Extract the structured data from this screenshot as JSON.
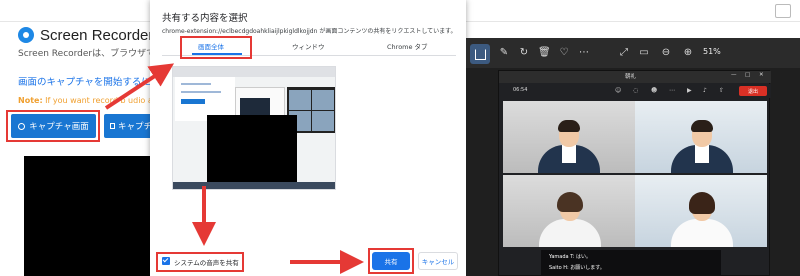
{
  "extension_page": {
    "title": "Screen Recorder for C",
    "description": "Screen Recorderは、ブラウザで画面",
    "start_text": "画面のキャプチャを開始するには",
    "note_label": "Note:",
    "note_text": " If you want record b   udio a",
    "capture_screen_button": "キャプチャ画面",
    "capture_camera_button": "キャプチ"
  },
  "share_dialog": {
    "title": "共有する内容を選択",
    "subtitle": "chrome-extension://eclbecdgdoahkliaijlpkigldlkojjdn が画面コンテンツの共有をリクエストしています。",
    "tabs": [
      {
        "label": "画面全体",
        "active": true
      },
      {
        "label": "ウィンドウ",
        "active": false
      },
      {
        "label": "Chrome タブ",
        "active": false
      }
    ],
    "share_audio_checked": true,
    "share_audio_label": "システムの音声を共有",
    "share_button": "共有",
    "cancel_button": "キャンセル"
  },
  "viewer": {
    "zoom": "51%",
    "toolbar_icons": [
      "home-icon",
      "edit-icon",
      "rotate-icon",
      "delete-icon",
      "favorite-icon",
      "more-icon",
      "fullscreen-icon",
      "fit-icon",
      "zoom-out-icon",
      "zoom-in-icon"
    ],
    "meeting": {
      "window_title": "朝礼",
      "time": "06:54",
      "leave_button": "退出",
      "chat": [
        {
          "name": "Yamada T:",
          "message": "はい。"
        },
        {
          "name": "Saito H:",
          "message": "お願いします。"
        }
      ]
    }
  },
  "colors": {
    "accent_blue": "#1a73e8",
    "capture_button_blue": "#1976d2",
    "highlight_red": "#e53935",
    "viewer_dark": "#1f1f1f",
    "leave_red": "#d93025"
  }
}
